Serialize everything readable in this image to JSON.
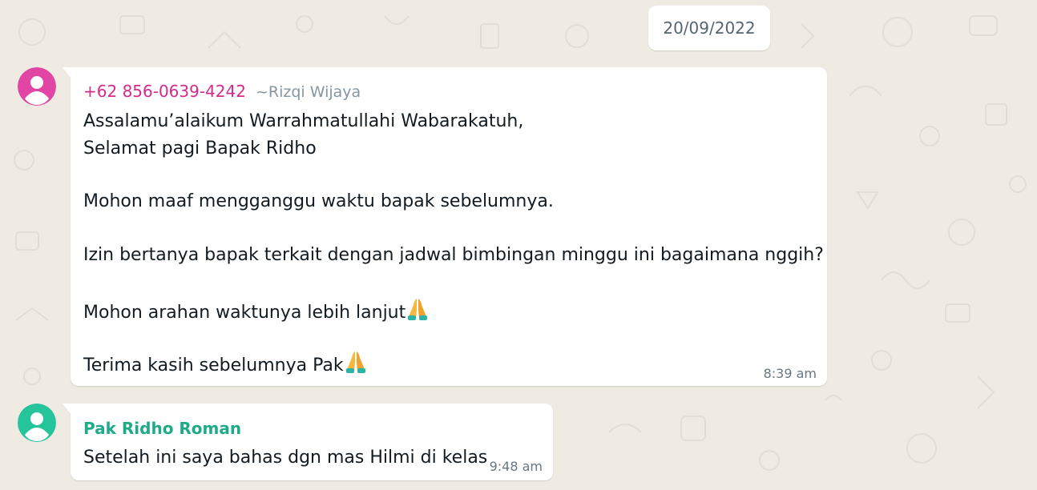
{
  "colors": {
    "wallpaper": "#efeae2",
    "bubble": "#ffffff",
    "sender1_color": "#d42a8b",
    "sender2_color": "#1fab89",
    "avatar1_bg": "#e246a5",
    "avatar2_bg": "#26c49a",
    "text": "#111b21",
    "meta": "#667781"
  },
  "date_divider": "20/09/2022",
  "messages": [
    {
      "sender_phone": "+62 856-0639-4242",
      "sender_push_name": "~Rizqi Wijaya",
      "avatar_icon": "default-user-avatar-icon",
      "lines": [
        "Assalamu’alaikum Warrahmatullahi Wabarakatuh,",
        "Selamat pagi Bapak Ridho",
        "Mohon maaf mengganggu waktu bapak sebelumnya.",
        "Izin bertanya bapak terkait dengan jadwal bimbingan minggu ini bagaimana nggih?",
        "Mohon arahan waktunya lebih lanjut",
        "Terima kasih sebelumnya Pak"
      ],
      "emoji": "praying-hands-emoji",
      "time": "8:39 am"
    },
    {
      "sender_name": "Pak Ridho Roman",
      "avatar_icon": "default-user-avatar-icon",
      "lines": [
        "Setelah ini saya bahas dgn mas Hilmi di kelas"
      ],
      "time": "9:48 am"
    }
  ]
}
